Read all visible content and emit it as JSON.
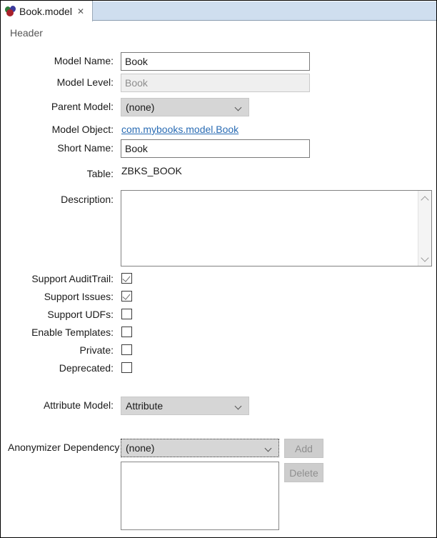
{
  "tab": {
    "title": "Book.model",
    "close_icon": "✕",
    "icon_name": "model-sphere-icon"
  },
  "section": {
    "header": "Header"
  },
  "fields": {
    "model_name": {
      "label": "Model Name:",
      "value": "Book"
    },
    "model_level": {
      "label": "Model Level:",
      "value": "Book"
    },
    "parent_model": {
      "label": "Parent Model:",
      "value": "(none)"
    },
    "model_object": {
      "label": "Model Object:",
      "value": "com.mybooks.model.Book"
    },
    "short_name": {
      "label": "Short Name:",
      "value": "Book"
    },
    "table": {
      "label": "Table:",
      "value": "ZBKS_BOOK"
    },
    "description": {
      "label": "Description:",
      "value": "",
      "placeholder": ""
    },
    "attribute_model": {
      "label": "Attribute Model:",
      "value": "Attribute"
    },
    "anonymizer_dependency": {
      "label": "Anonymizer Dependency",
      "value": "(none)"
    }
  },
  "checkboxes": [
    {
      "label": "Support AuditTrail:",
      "checked": true,
      "name": "support-audittrail"
    },
    {
      "label": "Support Issues:",
      "checked": true,
      "name": "support-issues"
    },
    {
      "label": "Support UDFs:",
      "checked": false,
      "name": "support-udfs"
    },
    {
      "label": "Enable Templates:",
      "checked": false,
      "name": "enable-templates"
    },
    {
      "label": "Private:",
      "checked": false,
      "name": "private"
    },
    {
      "label": "Deprecated:",
      "checked": false,
      "name": "deprecated"
    }
  ],
  "buttons": {
    "add": "Add",
    "delete": "Delete"
  },
  "colors": {
    "link": "#2a6cb4",
    "tab_strip": "#cfdeef",
    "disabled_text": "#8f8f8f",
    "combo_bg": "#d6d6d6"
  }
}
